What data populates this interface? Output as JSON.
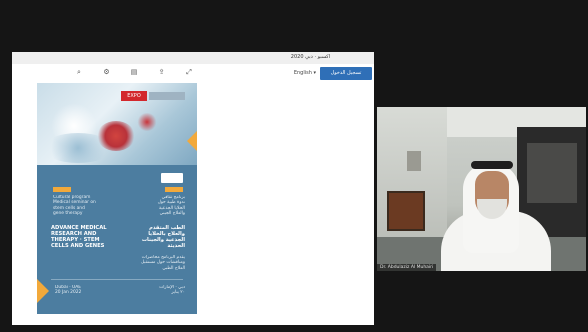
{
  "share_window": {
    "title": "اكسبو · دبي 2020",
    "sign_in_label": "تسجيل الدخول",
    "language_label": "English ▾"
  },
  "toolbar": {
    "icons": [
      "zoom-icon",
      "settings-icon",
      "print-icon",
      "share-icon",
      "fullscreen-icon"
    ],
    "glyphs": [
      "⌕",
      "⚙",
      "▤",
      "⇪",
      "⤢"
    ]
  },
  "poster": {
    "logo_text": "EXPO",
    "section1_right": "برنامج ثقافي\nندوة طبية حول\nالخلايا الجذعية\nوالعلاج الجيني",
    "section1_left": "Cultural program\nMedical seminar on\nstem cells and\ngene therapy",
    "heading_en": "ADVANCE MEDICAL\nRESEARCH AND\nTHERAPY · STEM\nCELLS AND GENES",
    "heading_ar": "الطب المتقدم\nوالعلاج بالخلايا\nالجذعية والجينات\nالحديثة",
    "body_ar": "يقدم البرنامج محاضرات\nومناقشات حول مستقبل\nالعلاج الطبي",
    "footer_left": "Dubai · UAE\n20 Jan 2022",
    "footer_right": "دبي · الإمارات\n٢٠ يناير"
  },
  "webcam": {
    "name_label": "Dr. Abdulaziz Al Muhairi"
  },
  "colors": {
    "poster_blue": "#4c7da0",
    "accent_orange": "#f2a93b",
    "brand_red": "#d3272c",
    "button_blue": "#2f6fb7"
  }
}
